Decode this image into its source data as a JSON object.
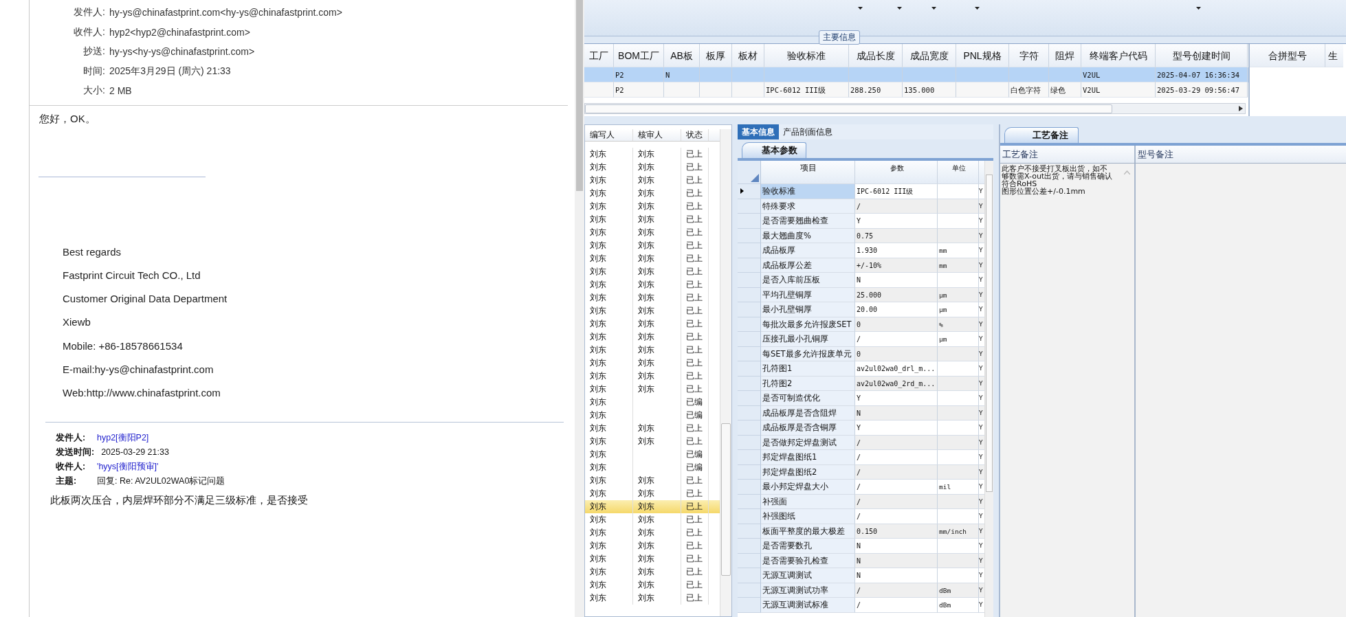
{
  "email": {
    "headers": [
      {
        "label": "发件人:",
        "value": "hy-ys@chinafastprint.com<hy-ys@chinafastprint.com>"
      },
      {
        "label": "收件人:",
        "value": "hyp2<hyp2@chinafastprint.com>"
      },
      {
        "label": "抄送:",
        "value": "hy-ys<hy-ys@chinafastprint.com>"
      },
      {
        "label": "时间:",
        "value": "2025年3月29日 (周六) 21:33"
      },
      {
        "label": "大小:",
        "value": "2 MB"
      }
    ],
    "greeting": "您好，OK。",
    "signature": [
      "Best regards",
      "Fastprint Circuit Tech CO., Ltd",
      "Customer Original Data Department",
      "Xiewb",
      "Mobile: +86-18578661534",
      "E-mail:hy-ys@chinafastprint.com",
      "Web:http://www.chinafastprint.com"
    ],
    "quoted": {
      "fields": [
        {
          "label": "发件人:",
          "value": "hyp2[衡阳P2]",
          "kind": "link"
        },
        {
          "label": "发送时间:",
          "value": "2025-03-29 21:33",
          "kind": "plain"
        },
        {
          "label": "收件人:",
          "value": "'hyys[衡阳预审]'",
          "kind": "link"
        },
        {
          "label": "主题:",
          "value": "回复: Re: AV2UL02WA0标记问题",
          "kind": "plain"
        }
      ],
      "body": "此板两次压合，内层焊环部分不满足三级标准，是否接受"
    }
  },
  "group_label": "主要信息",
  "top_table": {
    "columns": [
      "工厂",
      "BOM工厂",
      "AB板",
      "板厚",
      "板材",
      "验收标准",
      "成品长度",
      "成品宽度",
      "PNL规格",
      "字符",
      "阻焊",
      "终端客户代码",
      "型号创建时间"
    ],
    "rows": [
      {
        "selected": true,
        "cells": [
          "",
          "P2",
          "N",
          "",
          "",
          "",
          "",
          "",
          "",
          "",
          "",
          "V2UL",
          "2025-04-07 16:36:34"
        ]
      },
      {
        "selected": false,
        "cells": [
          "",
          "P2",
          "",
          "",
          "",
          "IPC-6012 III级",
          "288.250",
          "135.000",
          "",
          "白色字符",
          "绿色",
          "V2UL",
          "2025-03-29 09:56:47"
        ]
      }
    ]
  },
  "side_table": {
    "columns": [
      "合拼型号",
      "生"
    ]
  },
  "list": {
    "columns": [
      "编写人",
      "核审人",
      "状态"
    ],
    "rows": [
      {
        "selected": false,
        "cells": [
          "刘东",
          "刘东",
          "已上"
        ]
      },
      {
        "selected": false,
        "cells": [
          "刘东",
          "刘东",
          "已上"
        ]
      },
      {
        "selected": false,
        "cells": [
          "刘东",
          "刘东",
          "已上"
        ]
      },
      {
        "selected": false,
        "cells": [
          "刘东",
          "刘东",
          "已上"
        ]
      },
      {
        "selected": false,
        "cells": [
          "刘东",
          "刘东",
          "已上"
        ]
      },
      {
        "selected": false,
        "cells": [
          "刘东",
          "刘东",
          "已上"
        ]
      },
      {
        "selected": false,
        "cells": [
          "刘东",
          "刘东",
          "已上"
        ]
      },
      {
        "selected": false,
        "cells": [
          "刘东",
          "刘东",
          "已上"
        ]
      },
      {
        "selected": false,
        "cells": [
          "刘东",
          "刘东",
          "已上"
        ]
      },
      {
        "selected": false,
        "cells": [
          "刘东",
          "刘东",
          "已上"
        ]
      },
      {
        "selected": false,
        "cells": [
          "刘东",
          "刘东",
          "已上"
        ]
      },
      {
        "selected": false,
        "cells": [
          "刘东",
          "刘东",
          "已上"
        ]
      },
      {
        "selected": false,
        "cells": [
          "刘东",
          "刘东",
          "已上"
        ]
      },
      {
        "selected": false,
        "cells": [
          "刘东",
          "刘东",
          "已上"
        ]
      },
      {
        "selected": false,
        "cells": [
          "刘东",
          "刘东",
          "已上"
        ]
      },
      {
        "selected": false,
        "cells": [
          "刘东",
          "刘东",
          "已上"
        ]
      },
      {
        "selected": false,
        "cells": [
          "刘东",
          "刘东",
          "已上"
        ]
      },
      {
        "selected": false,
        "cells": [
          "刘东",
          "刘东",
          "已上"
        ]
      },
      {
        "selected": false,
        "cells": [
          "刘东",
          "刘东",
          "已上"
        ]
      },
      {
        "selected": false,
        "cells": [
          "刘东",
          "",
          "已编"
        ]
      },
      {
        "selected": false,
        "cells": [
          "刘东",
          "",
          "已编"
        ]
      },
      {
        "selected": false,
        "cells": [
          "刘东",
          "刘东",
          "已上"
        ]
      },
      {
        "selected": false,
        "cells": [
          "刘东",
          "刘东",
          "已上"
        ]
      },
      {
        "selected": false,
        "cells": [
          "刘东",
          "",
          "已编"
        ]
      },
      {
        "selected": false,
        "cells": [
          "刘东",
          "",
          "已编"
        ]
      },
      {
        "selected": false,
        "cells": [
          "刘东",
          "刘东",
          "已上"
        ]
      },
      {
        "selected": false,
        "cells": [
          "刘东",
          "刘东",
          "已上"
        ]
      },
      {
        "selected": true,
        "cells": [
          "刘东",
          "刘东",
          "已上"
        ]
      },
      {
        "selected": false,
        "cells": [
          "刘东",
          "刘东",
          "已上"
        ]
      },
      {
        "selected": false,
        "cells": [
          "刘东",
          "刘东",
          "已上"
        ]
      },
      {
        "selected": false,
        "cells": [
          "刘东",
          "刘东",
          "已上"
        ]
      },
      {
        "selected": false,
        "cells": [
          "刘东",
          "刘东",
          "已上"
        ]
      },
      {
        "selected": false,
        "cells": [
          "刘东",
          "刘东",
          "已上"
        ]
      },
      {
        "selected": false,
        "cells": [
          "刘东",
          "刘东",
          "已上"
        ]
      },
      {
        "selected": false,
        "cells": [
          "刘东",
          "刘东",
          "已上"
        ]
      }
    ]
  },
  "tabs": [
    {
      "label": "基本信息",
      "selected": true
    },
    {
      "label": "产品剖面信息",
      "selected": false
    }
  ],
  "params": {
    "tab": "基本参数",
    "columns": [
      "项目",
      "参数",
      "单位"
    ],
    "rows": [
      {
        "selected": true,
        "item": "验收标准",
        "value": "IPC-6012 III级",
        "unit": "",
        "flag": "Y"
      },
      {
        "selected": false,
        "item": "特殊要求",
        "value": "/",
        "unit": "",
        "flag": "Y"
      },
      {
        "selected": false,
        "item": "是否需要翘曲检查",
        "value": "Y",
        "unit": "",
        "flag": "Y"
      },
      {
        "selected": false,
        "item": "最大翘曲度%",
        "value": "0.75",
        "unit": "",
        "flag": "Y"
      },
      {
        "selected": false,
        "item": "成品板厚",
        "value": "1.930",
        "unit": "mm",
        "flag": "Y"
      },
      {
        "selected": false,
        "item": "成品板厚公差",
        "value": "+/-10%",
        "unit": "mm",
        "flag": "Y"
      },
      {
        "selected": false,
        "item": "是否入库前压板",
        "value": "N",
        "unit": "",
        "flag": "Y"
      },
      {
        "selected": false,
        "item": "平均孔壁铜厚",
        "value": "25.000",
        "unit": "μm",
        "flag": "Y"
      },
      {
        "selected": false,
        "item": "最小孔壁铜厚",
        "value": "20.00",
        "unit": "μm",
        "flag": "Y"
      },
      {
        "selected": false,
        "item": "每批次最多允许报废SET",
        "value": "0",
        "unit": "%",
        "flag": "Y"
      },
      {
        "selected": false,
        "item": "压接孔最小孔铜厚",
        "value": "/",
        "unit": "μm",
        "flag": "Y"
      },
      {
        "selected": false,
        "item": "每SET最多允许报废单元",
        "value": "0",
        "unit": "",
        "flag": "Y"
      },
      {
        "selected": false,
        "item": "孔符图1",
        "value": "av2ul02wa0_drl_m...",
        "unit": "",
        "flag": "Y"
      },
      {
        "selected": false,
        "item": "孔符图2",
        "value": "av2ul02wa0_2rd_m...",
        "unit": "",
        "flag": "Y"
      },
      {
        "selected": false,
        "item": "是否可制造优化",
        "value": "Y",
        "unit": "",
        "flag": "Y"
      },
      {
        "selected": false,
        "item": "成品板厚是否含阻焊",
        "value": "N",
        "unit": "",
        "flag": "Y"
      },
      {
        "selected": false,
        "item": "成品板厚是否含铜厚",
        "value": "Y",
        "unit": "",
        "flag": "Y"
      },
      {
        "selected": false,
        "item": "是否做邦定焊盘测试",
        "value": "/",
        "unit": "",
        "flag": "Y"
      },
      {
        "selected": false,
        "item": "邦定焊盘图纸1",
        "value": "/",
        "unit": "",
        "flag": "Y"
      },
      {
        "selected": false,
        "item": "邦定焊盘图纸2",
        "value": "/",
        "unit": "",
        "flag": "Y"
      },
      {
        "selected": false,
        "item": "最小邦定焊盘大小",
        "value": "/",
        "unit": "mil",
        "flag": "Y"
      },
      {
        "selected": false,
        "item": "补强面",
        "value": "/",
        "unit": "",
        "flag": "Y"
      },
      {
        "selected": false,
        "item": "补强图纸",
        "value": "/",
        "unit": "",
        "flag": "Y"
      },
      {
        "selected": false,
        "item": "板面平整度的最大极差",
        "value": "0.150",
        "unit": "mm/inch",
        "flag": "Y"
      },
      {
        "selected": false,
        "item": "是否需要数孔",
        "value": "N",
        "unit": "",
        "flag": "Y"
      },
      {
        "selected": false,
        "item": "是否需要验孔检查",
        "value": "N",
        "unit": "",
        "flag": "Y"
      },
      {
        "selected": false,
        "item": "无源互调测试",
        "value": "N",
        "unit": "",
        "flag": "Y"
      },
      {
        "selected": false,
        "item": "无源互调测试功率",
        "value": "/",
        "unit": "dBm",
        "flag": "Y"
      },
      {
        "selected": false,
        "item": "无源互调测试标准",
        "value": "/",
        "unit": "dBm",
        "flag": "Y"
      }
    ]
  },
  "notes": {
    "tab": "工艺备注",
    "columns": [
      "工艺备注",
      "型号备注"
    ],
    "lines": [
      "此客户不接受打叉板出货，如不",
      "够数需X-out出货，请与销售确认",
      "符合RoHS",
      "图形位置公差+/-0.1mm"
    ]
  }
}
